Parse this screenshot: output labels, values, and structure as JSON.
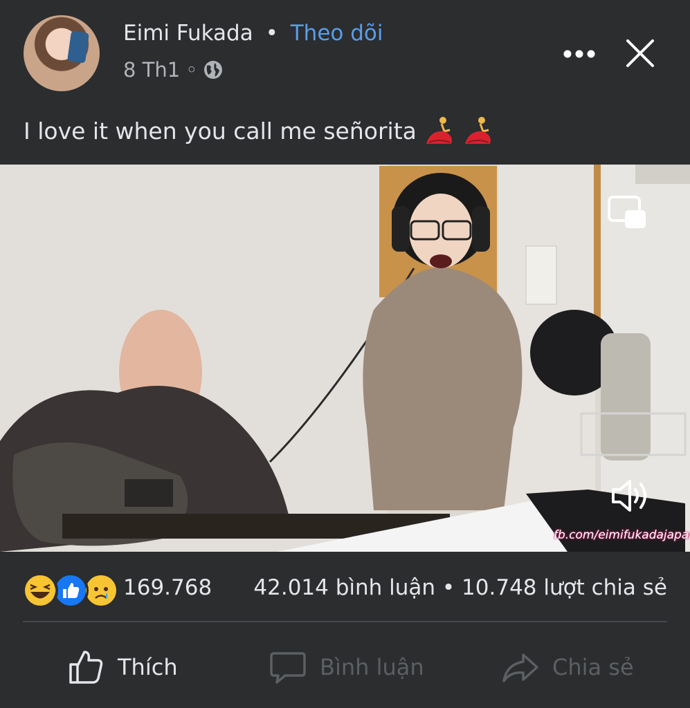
{
  "post": {
    "author": "Eimi Fukada",
    "separator": "•",
    "follow_label": "Theo dõi",
    "date": "8 Th1",
    "meta_separator": "◦",
    "privacy_icon": "globe-icon",
    "caption": "I love it when you call me señorita",
    "caption_emoji": "dancer-emoji"
  },
  "video": {
    "watermark": "fb.com/eimifukadajapan",
    "pip_icon": "picture-in-picture-icon",
    "volume_icon": "speaker-icon"
  },
  "stats": {
    "reactions": [
      "laughing-emoji",
      "like-emoji",
      "sad-emoji"
    ],
    "reaction_count": "169.768",
    "comments_and_shares": "42.014 bình luận • 10.748 lượt chia sẻ"
  },
  "actions": {
    "like_label": "Thích",
    "comment_label": "Bình luận",
    "share_label": "Chia sẻ"
  },
  "colors": {
    "background": "#2b2d2f",
    "text": "#e4e6eb",
    "follow_link": "#5a9ee8",
    "muted": "#5c5f63",
    "like_blue": "#1877f2"
  }
}
